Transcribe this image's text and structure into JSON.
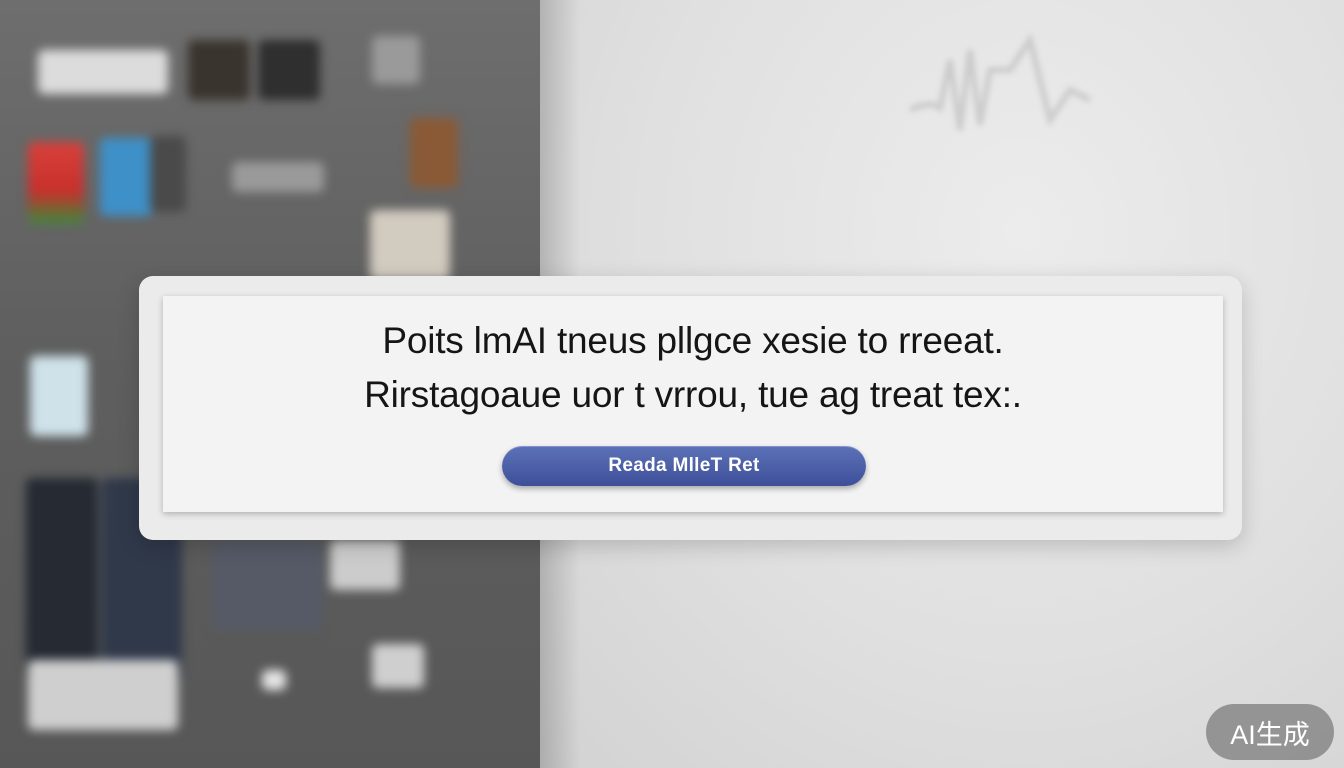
{
  "dialog": {
    "line1": "Poits lmAI  tneus pllgce xesie to rreeat.",
    "line2": "Rirstagoaue uor  t  vrrou, tue  ag treat tex:.",
    "button_label": "Reada MlleT Ret"
  },
  "badge": {
    "label": "AI生成"
  },
  "colors": {
    "button": "#4a5ea8",
    "dialog_panel": "#f3f3f3",
    "background_left": "#636363",
    "background_right": "#e4e4e4"
  }
}
